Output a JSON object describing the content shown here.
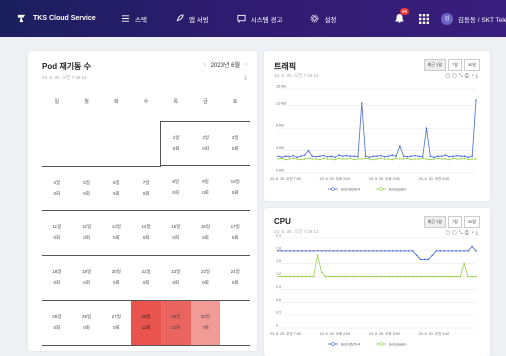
{
  "nav": {
    "brand": "TKS Cloud Service",
    "menu": [
      {
        "label": "스택",
        "icon": "list-icon"
      },
      {
        "label": "앱 서빙",
        "icon": "rocket-icon"
      },
      {
        "label": "시스템 경고",
        "icon": "message-icon"
      },
      {
        "label": "설정",
        "icon": "gear-icon"
      }
    ],
    "notif_count": "99",
    "avatar_initial": "김",
    "user": "김동동 / SKT Telec"
  },
  "pod_card": {
    "title": "Pod 재기동 수",
    "subtitle": "23. 6. 30. 오전 7:49:13",
    "month": "2023년 6월",
    "weekdays": [
      "일",
      "월",
      "화",
      "수",
      "목",
      "금",
      "토"
    ],
    "weeks": [
      [
        null,
        null,
        null,
        null,
        {
          "d": "1일",
          "v": "0회"
        },
        {
          "d": "2일",
          "v": "0회"
        },
        {
          "d": "3일",
          "v": "0회"
        }
      ],
      [
        {
          "d": "4일",
          "v": "0회"
        },
        {
          "d": "5일",
          "v": "0회"
        },
        {
          "d": "6일",
          "v": "0회"
        },
        {
          "d": "7일",
          "v": "0회"
        },
        {
          "d": "8일",
          "v": "0회"
        },
        {
          "d": "9일",
          "v": "0회"
        },
        {
          "d": "10일",
          "v": "0회"
        }
      ],
      [
        {
          "d": "11일",
          "v": "0회"
        },
        {
          "d": "12일",
          "v": "0회"
        },
        {
          "d": "13일",
          "v": "0회"
        },
        {
          "d": "14일",
          "v": "0회"
        },
        {
          "d": "15일",
          "v": "0회"
        },
        {
          "d": "16일",
          "v": "0회"
        },
        {
          "d": "17일",
          "v": "0회"
        }
      ],
      [
        {
          "d": "18일",
          "v": "0회"
        },
        {
          "d": "19일",
          "v": "0회"
        },
        {
          "d": "20일",
          "v": "0회"
        },
        {
          "d": "21일",
          "v": "0회"
        },
        {
          "d": "22일",
          "v": "0회"
        },
        {
          "d": "23일",
          "v": "0회"
        },
        {
          "d": "24일",
          "v": "0회"
        }
      ],
      [
        {
          "d": "25일",
          "v": "0회"
        },
        {
          "d": "26일",
          "v": "0회"
        },
        {
          "d": "27일",
          "v": "0회"
        },
        {
          "d": "28일",
          "v": "11회",
          "hl": "hl1"
        },
        {
          "d": "29일",
          "v": "22회",
          "hl": "hl2"
        },
        {
          "d": "30일",
          "v": "7회",
          "hl": "hl3"
        },
        null
      ]
    ]
  },
  "traffic": {
    "title": "트래픽",
    "subtitle": "23. 6. 30. 오전 7:49:13",
    "tabs": [
      "최근 1일",
      "7일",
      "30일"
    ],
    "active_tab": 0
  },
  "cpu": {
    "title": "CPU",
    "subtitle": "23. 6. 30. 오전 7:49:13",
    "tabs": [
      "최근 1일",
      "7일",
      "30일"
    ],
    "active_tab": 0
  },
  "chart_data": [
    {
      "type": "line",
      "title": "트래픽",
      "ylim": [
        0,
        15
      ],
      "yticks": [
        "0 KB",
        "4 KB",
        "8 KB",
        "12 KB",
        "15 KB"
      ],
      "yvals": [
        0,
        4,
        8,
        12,
        15
      ],
      "xticks": [
        "23. 6. 29. 오전 7:00",
        "23. 6. 29. 오후 2:00",
        "23. 6. 29. 오후 9:00",
        "23. 6. 30. 오전 4:00"
      ],
      "series": [
        {
          "name": "test-0629-4",
          "color": "#4a6bd6",
          "values": [
            3,
            2.8,
            3,
            2.9,
            3.1,
            2.8,
            3,
            3.2,
            4,
            3,
            2.9,
            3,
            3.1,
            2.9,
            3,
            2.8,
            3.2,
            3,
            3.1,
            3,
            3,
            2.9,
            12.5,
            3,
            2.8,
            3,
            3,
            3.1,
            2.9,
            3,
            3.2,
            3,
            4.8,
            3,
            2.9,
            3,
            3.1,
            3,
            2.9,
            8,
            3,
            2.8,
            3,
            3,
            3.2,
            2.9,
            3,
            3.1,
            3,
            3,
            2.8,
            3,
            13
          ]
        },
        {
          "name": "test-jiyahn",
          "color": "#9bd14f",
          "values": [
            2.5,
            2.6,
            2.4,
            2.5,
            2.6,
            2.5,
            2.4,
            2.5,
            2.6,
            2.5,
            2.5,
            2.4,
            2.6,
            2.5,
            2.5,
            2.4,
            2.6,
            2.5,
            2.5,
            2.6,
            2.4,
            2.5,
            2.5,
            2.6,
            2.5,
            2.4,
            2.5,
            2.6,
            2.5,
            2.5,
            2.4,
            2.6,
            2.5,
            2.5,
            2.6,
            2.4,
            2.5,
            2.5,
            2.6,
            2.5,
            2.4,
            2.5,
            2.6,
            2.5,
            2.5,
            2.4,
            2.6,
            2.5,
            2.5,
            2.6,
            2.4,
            2.5,
            2.5
          ]
        }
      ]
    },
    {
      "type": "line",
      "title": "CPU",
      "ylim": [
        0,
        2.1
      ],
      "yticks": [
        "0",
        "0.3",
        "0.6",
        "0.9",
        "1.2",
        "1.5",
        "1.8",
        "2.1"
      ],
      "yvals": [
        0,
        0.3,
        0.6,
        0.9,
        1.2,
        1.5,
        1.8,
        2.1
      ],
      "xticks": [
        "23. 6. 29. 오전 7:00",
        "23. 6. 29. 오후 2:00",
        "23. 6. 29. 오후 9:00",
        "23. 6. 30. 오전 4:00"
      ],
      "series": [
        {
          "name": "test-0629-4",
          "color": "#4a6bd6",
          "values": [
            1.8,
            1.8,
            1.8,
            1.8,
            1.8,
            1.8,
            1.8,
            1.8,
            1.8,
            1.8,
            1.8,
            1.8,
            1.8,
            1.8,
            1.8,
            1.8,
            1.8,
            1.8,
            1.8,
            1.8,
            1.8,
            1.8,
            1.8,
            1.8,
            1.8,
            1.8,
            1.8,
            1.8,
            1.8,
            1.8,
            1.8,
            1.8,
            1.8,
            1.8,
            1.8,
            1.7,
            1.6,
            1.6,
            1.6,
            1.7,
            1.8,
            1.8,
            1.8,
            1.8,
            1.8,
            1.8,
            1.8,
            1.8,
            1.8,
            1.9,
            1.8
          ]
        },
        {
          "name": "test-jiyahn",
          "color": "#9bd14f",
          "values": [
            1.2,
            1.2,
            1.2,
            1.2,
            1.2,
            1.2,
            1.2,
            1.2,
            1.2,
            1.2,
            1.7,
            1.3,
            1.2,
            1.2,
            1.2,
            1.2,
            1.2,
            1.2,
            1.2,
            1.2,
            1.2,
            1.2,
            1.2,
            1.2,
            1.2,
            1.2,
            1.2,
            1.2,
            1.2,
            1.2,
            1.2,
            1.2,
            1.2,
            1.2,
            1.2,
            1.2,
            1.2,
            1.2,
            1.2,
            1.2,
            1.2,
            1.2,
            1.2,
            1.2,
            1.2,
            1.2,
            1.2,
            1.5,
            1.2,
            1.2,
            1.2
          ]
        }
      ]
    }
  ]
}
